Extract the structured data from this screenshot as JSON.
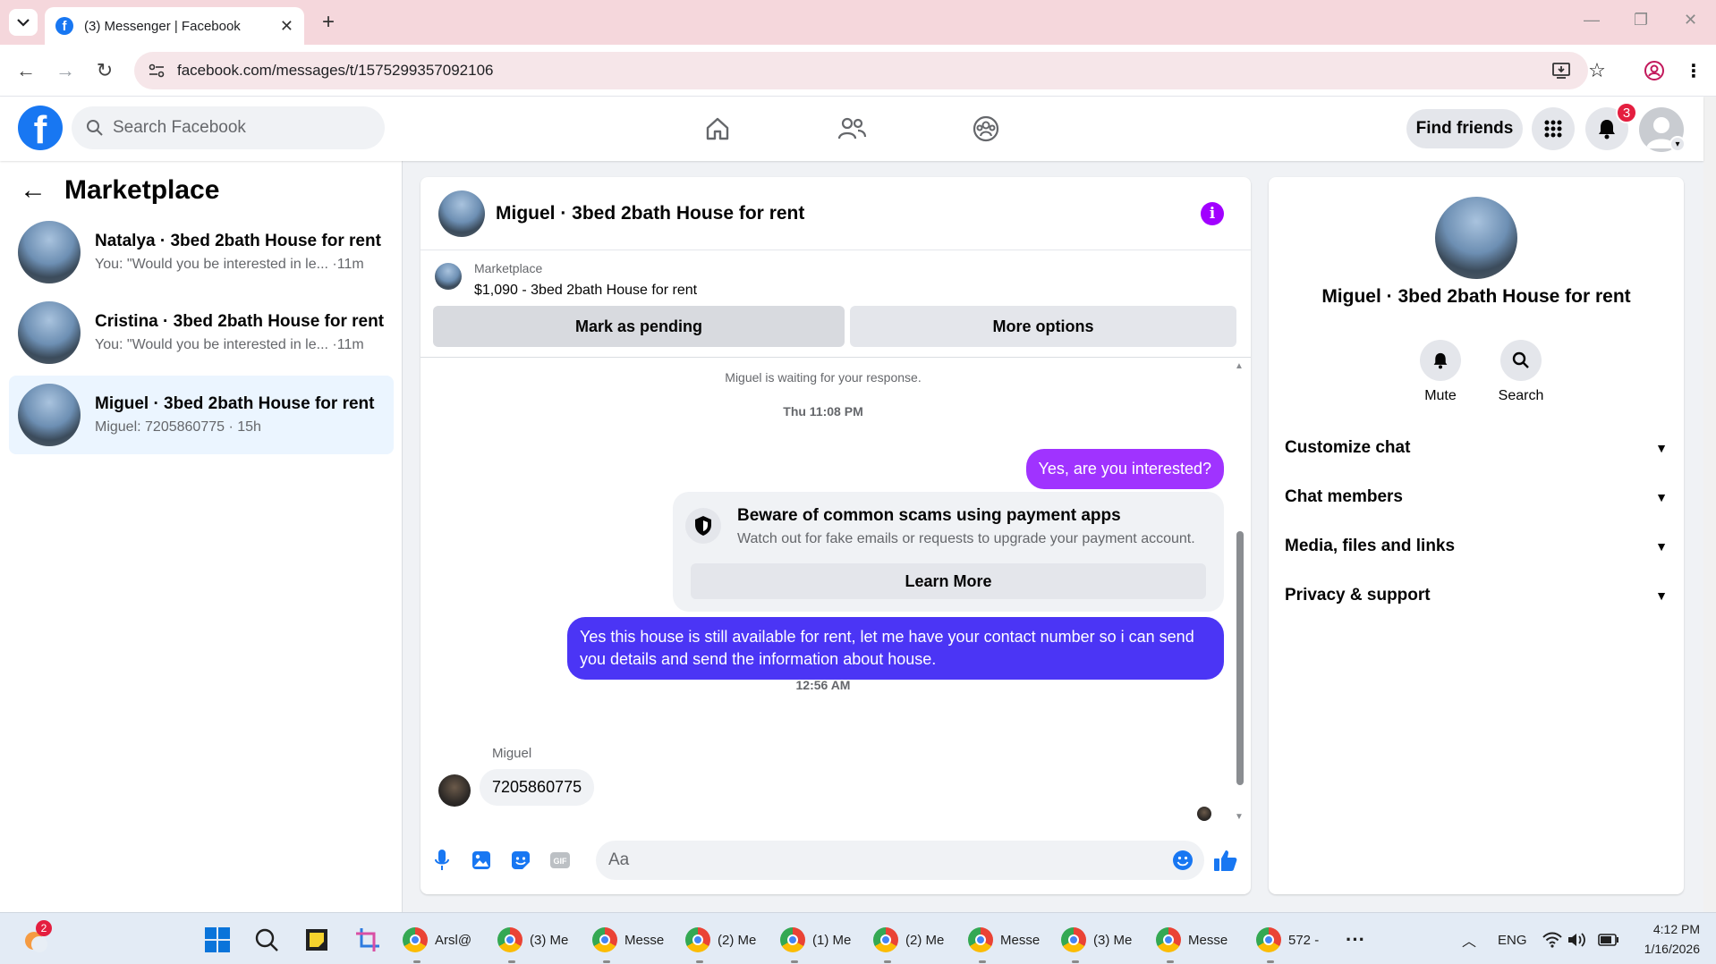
{
  "browser": {
    "tab_title": "(3) Messenger | Facebook",
    "url": "facebook.com/messages/t/1575299357092106"
  },
  "fb": {
    "logo": "f",
    "search_placeholder": "Search Facebook",
    "find_friends": "Find friends",
    "notification_count": "3"
  },
  "sidebar": {
    "title": "Marketplace",
    "conversations": [
      {
        "title": "Natalya · 3bed 2bath House for rent",
        "subtitle": "You: \"Would you be interested in le... ·11m"
      },
      {
        "title": "Cristina · 3bed 2bath House for rent",
        "subtitle": "You: \"Would you be interested in le... ·11m"
      },
      {
        "title": "Miguel · 3bed 2bath House for rent",
        "subtitle": "Miguel: 7205860775 · 15h"
      }
    ]
  },
  "chat": {
    "title": "Miguel · 3bed 2bath House for rent",
    "marketplace_label": "Marketplace",
    "listing": "$1,090 - 3bed 2bath House for rent",
    "mark_pending": "Mark as pending",
    "more_options": "More options",
    "waiting": "Miguel is waiting for your response.",
    "time1": "Thu 11:08 PM",
    "msg_out_1": "Yes, are you interested?",
    "scam_title": "Beware of common scams using payment apps",
    "scam_sub": "Watch out for fake emails or requests to upgrade your payment account.",
    "learn_more": "Learn More",
    "msg_out_2": "Yes this house is still available for rent, let me have your contact number so i can send you details and send the information about house.",
    "time2": "12:56 AM",
    "sender": "Miguel",
    "msg_in_1": "7205860775",
    "composer_placeholder": "Aa",
    "gif_label": "GIF"
  },
  "info": {
    "title": "Miguel · 3bed 2bath House for rent",
    "mute": "Mute",
    "search": "Search",
    "sections": [
      "Customize chat",
      "Chat members",
      "Media, files and links",
      "Privacy & support"
    ]
  },
  "taskbar": {
    "badge": "2",
    "items": [
      "Arsl@",
      "(3) Me",
      "Messe",
      "(2) Me",
      "(1) Me",
      "(2) Me",
      "Messe",
      "(3) Me",
      "Messe",
      "572 -"
    ],
    "lang": "ENG",
    "time": "4:12 PM",
    "date": "1/16/2026"
  },
  "colors": {
    "fb_blue": "#1877f2",
    "bubble_purple": "#a033ff",
    "bubble_indigo": "#4b35f5",
    "badge_red": "#e41e3f"
  }
}
